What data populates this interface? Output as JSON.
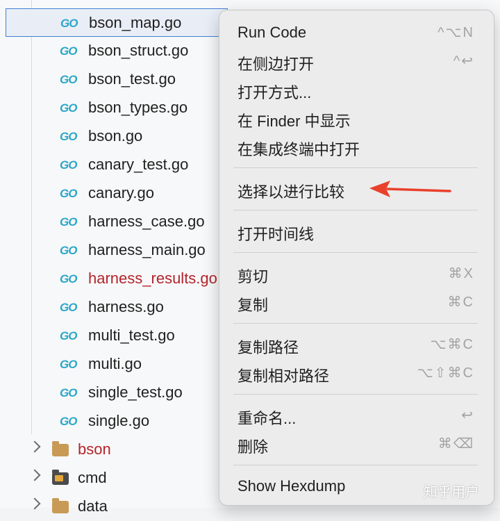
{
  "files": [
    {
      "name": "bson_map.go",
      "selected": true
    },
    {
      "name": "bson_struct.go"
    },
    {
      "name": "bson_test.go"
    },
    {
      "name": "bson_types.go"
    },
    {
      "name": "bson.go"
    },
    {
      "name": "canary_test.go"
    },
    {
      "name": "canary.go"
    },
    {
      "name": "harness_case.go"
    },
    {
      "name": "harness_main.go"
    },
    {
      "name": "harness_results.go",
      "error": true
    },
    {
      "name": "harness.go"
    },
    {
      "name": "multi_test.go"
    },
    {
      "name": "multi.go"
    },
    {
      "name": "single_test.go"
    },
    {
      "name": "single.go"
    }
  ],
  "file_icon": "GO",
  "folders": [
    {
      "name": "bson",
      "icon": "folder-icon",
      "error": true
    },
    {
      "name": "cmd",
      "icon": "terminal-folder-icon"
    },
    {
      "name": "data",
      "icon": "folder-icon"
    }
  ],
  "menu": {
    "groups": [
      [
        {
          "label": "Run Code",
          "shortcut": "^⌥N"
        },
        {
          "label": "在侧边打开",
          "shortcut": "^↩"
        },
        {
          "label": "打开方式...",
          "shortcut": ""
        },
        {
          "label": "在 Finder 中显示",
          "shortcut": ""
        },
        {
          "label": "在集成终端中打开",
          "shortcut": ""
        }
      ],
      [
        {
          "label": "选择以进行比较",
          "shortcut": ""
        }
      ],
      [
        {
          "label": "打开时间线",
          "shortcut": ""
        }
      ],
      [
        {
          "label": "剪切",
          "shortcut": "⌘X"
        },
        {
          "label": "复制",
          "shortcut": "⌘C"
        }
      ],
      [
        {
          "label": "复制路径",
          "shortcut": "⌥⌘C"
        },
        {
          "label": "复制相对路径",
          "shortcut": "⌥⇧⌘C"
        }
      ],
      [
        {
          "label": "重命名...",
          "shortcut": "↩"
        },
        {
          "label": "删除",
          "shortcut": "⌘⌫"
        }
      ],
      [
        {
          "label": "Show Hexdump",
          "shortcut": ""
        }
      ]
    ]
  },
  "annotation": {
    "icon": "red-arrow-icon",
    "color": "#e8412c"
  },
  "watermark": "知乎用户"
}
